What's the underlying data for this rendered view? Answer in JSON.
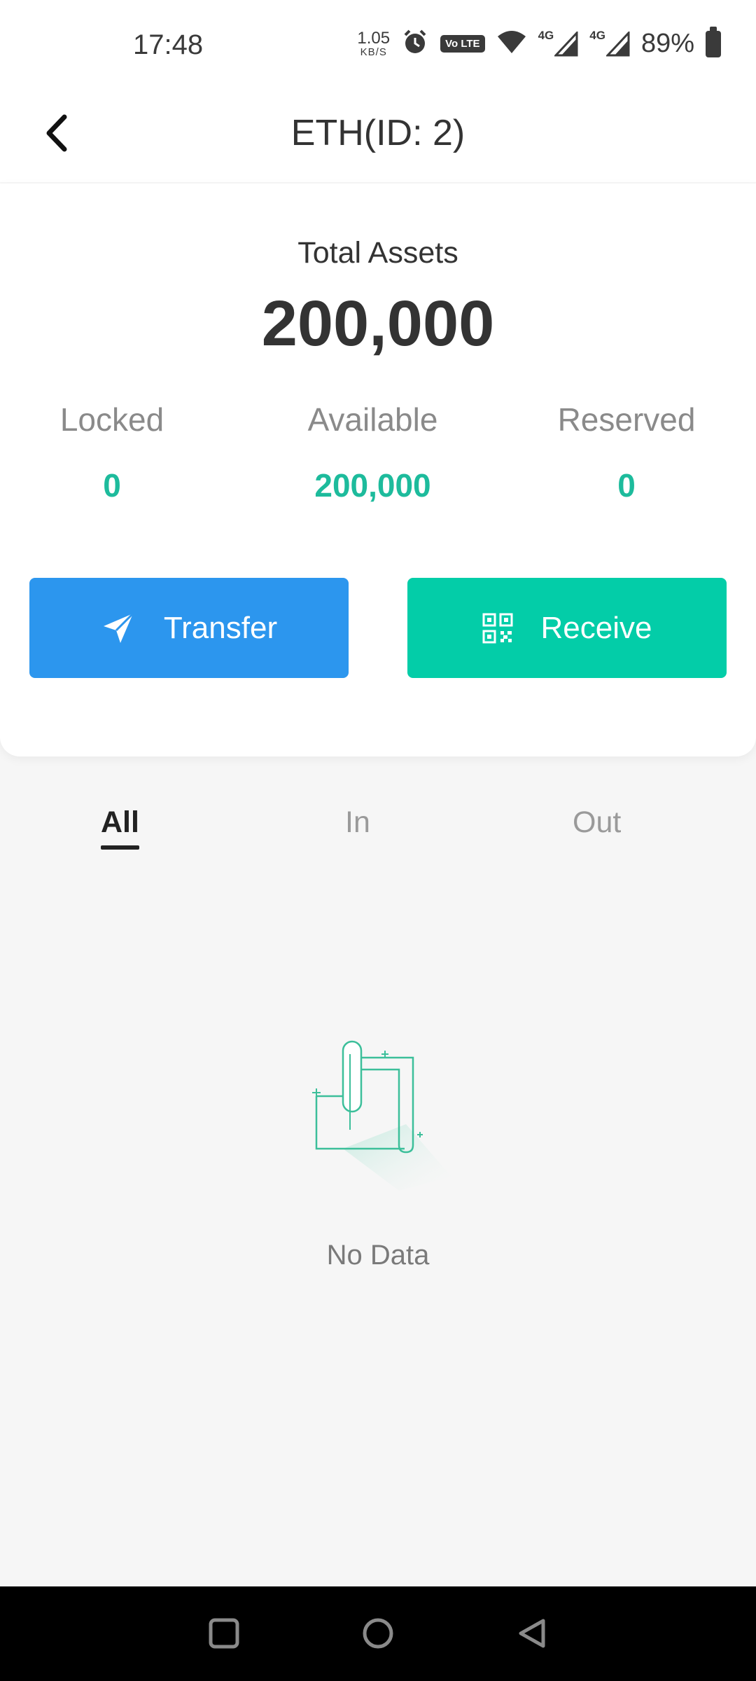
{
  "status_bar": {
    "time": "17:48",
    "net_speed": "1.05",
    "net_unit": "KB/S",
    "volte": "Vo LTE",
    "sim1": "4G",
    "sim2": "4G",
    "battery": "89%"
  },
  "header": {
    "title": "ETH(ID: 2)",
    "back_icon": "chevron-left-icon"
  },
  "assets": {
    "total_label": "Total Assets",
    "total_value": "200,000",
    "locked_label": "Locked",
    "locked_value": "0",
    "available_label": "Available",
    "available_value": "200,000",
    "reserved_label": "Reserved",
    "reserved_value": "0"
  },
  "actions": {
    "transfer_label": "Transfer",
    "transfer_icon": "paper-plane-icon",
    "transfer_color": "#2c96ee",
    "receive_label": "Receive",
    "receive_icon": "qr-code-icon",
    "receive_color": "#03cda8"
  },
  "tabs": [
    {
      "label": "All",
      "active": true
    },
    {
      "label": "In",
      "active": false
    },
    {
      "label": "Out",
      "active": false
    }
  ],
  "empty": {
    "text": "No Data",
    "icon": "empty-document-icon"
  },
  "colors": {
    "accent_green": "#1dbb9c",
    "background": "#f6f6f6"
  }
}
